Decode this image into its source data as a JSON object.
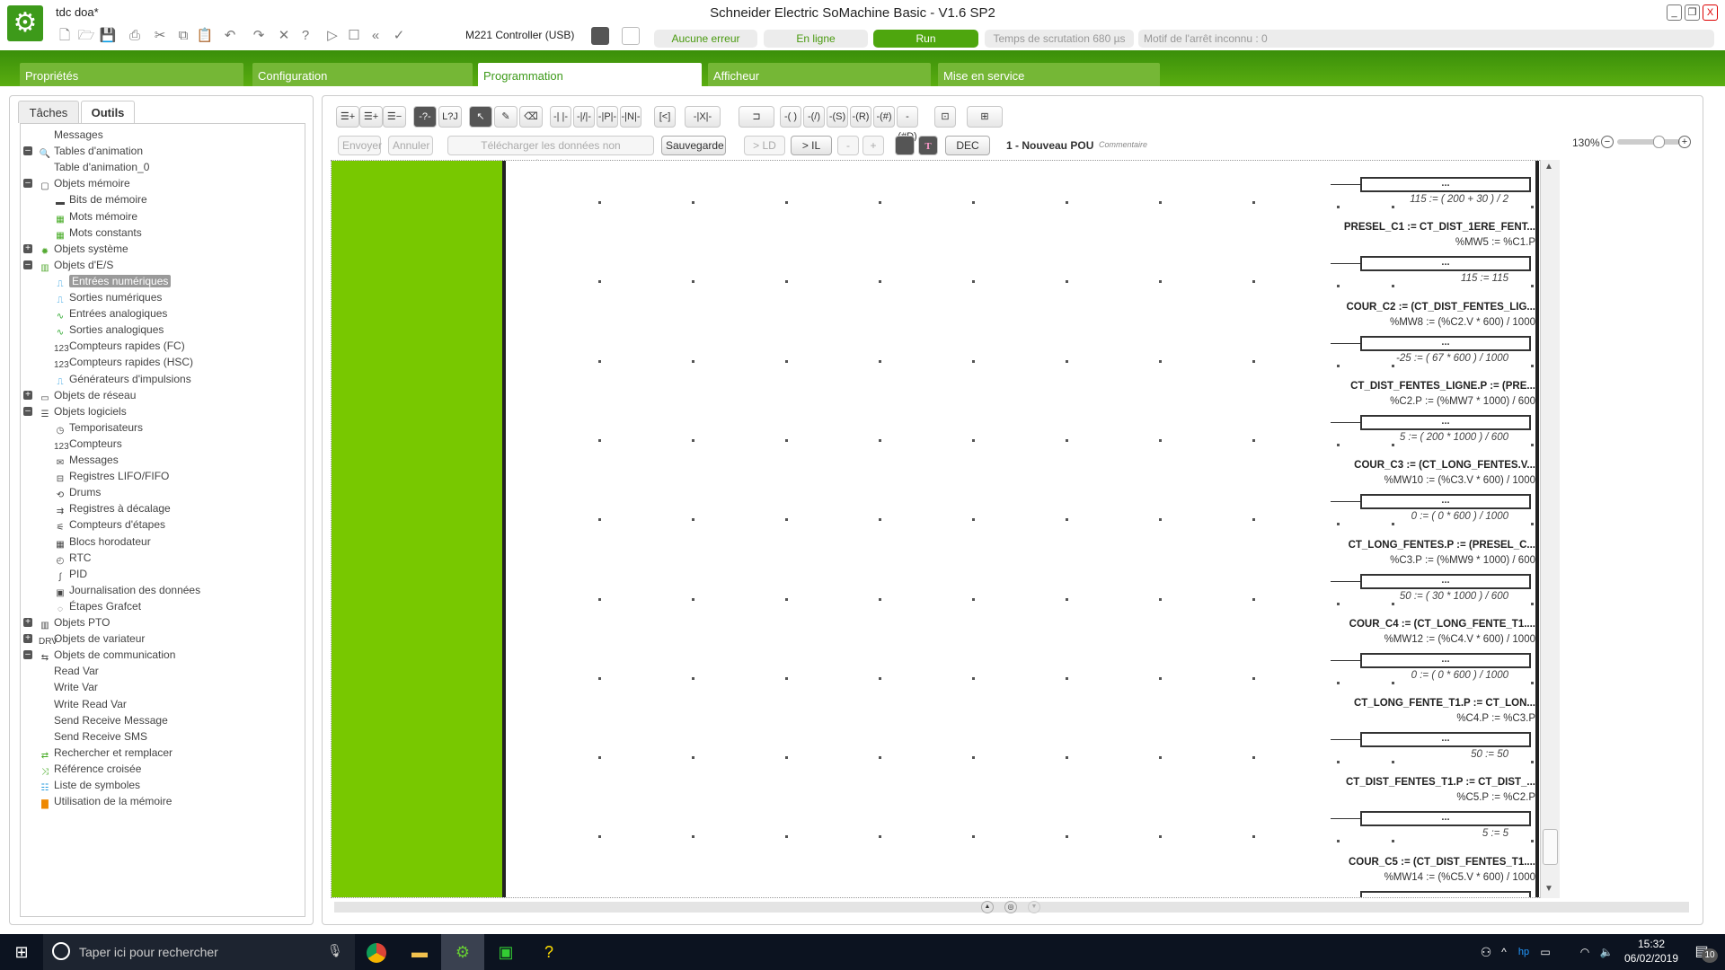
{
  "window": {
    "doc_title": "tdc doa*",
    "app_title": "Schneider Electric SoMachine Basic - V1.6 SP2",
    "min": "_",
    "restore": "❐",
    "close": "X"
  },
  "toolbar": {
    "controller": "M221 Controller (USB)",
    "icons": [
      "new-file-icon",
      "open-folder-icon",
      "save-icon",
      "print-icon",
      "cut-icon",
      "copy-icon",
      "paste-icon",
      "undo-icon",
      "redo-icon",
      "tools-icon",
      "help-icon",
      "start-icon",
      "stop-icon",
      "rewind-icon",
      "check-icon"
    ]
  },
  "status": {
    "error": "Aucune erreur",
    "online": "En ligne",
    "run": "Run",
    "scan": "Temps de scrutation 680 µs",
    "stop_reason": "Motif de l'arrêt inconnu : 0"
  },
  "main_tabs": [
    "Propriétés",
    "Configuration",
    "Programmation",
    "Afficheur",
    "Mise en service"
  ],
  "left_tabs": [
    "Tâches",
    "Outils"
  ],
  "tree": [
    {
      "label": "Messages",
      "level": 0,
      "exp": null,
      "icon": null
    },
    {
      "label": "Tables d'animation",
      "level": 0,
      "exp": "-",
      "icon": "magnifier"
    },
    {
      "label": "Table d'animation_0",
      "level": 1,
      "exp": null,
      "icon": null
    },
    {
      "label": "Objets mémoire",
      "level": 0,
      "exp": "-",
      "icon": "cube"
    },
    {
      "label": "Bits de mémoire",
      "level": 1,
      "exp": null,
      "icon": "bits"
    },
    {
      "label": "Mots mémoire",
      "level": 1,
      "exp": null,
      "icon": "words"
    },
    {
      "label": "Mots constants",
      "level": 1,
      "exp": null,
      "icon": "words"
    },
    {
      "label": "Objets système",
      "level": 0,
      "exp": "+",
      "icon": "gear"
    },
    {
      "label": "Objets d'E/S",
      "level": 0,
      "exp": "-",
      "icon": "io"
    },
    {
      "label": "Entrées numériques",
      "level": 1,
      "exp": null,
      "icon": "din",
      "selected": true
    },
    {
      "label": "Sorties numériques",
      "level": 1,
      "exp": null,
      "icon": "dout"
    },
    {
      "label": "Entrées analogiques",
      "level": 1,
      "exp": null,
      "icon": "ain"
    },
    {
      "label": "Sorties analogiques",
      "level": 1,
      "exp": null,
      "icon": "aout"
    },
    {
      "label": "Compteurs rapides (FC)",
      "level": 1,
      "exp": null,
      "icon": "counter"
    },
    {
      "label": "Compteurs rapides (HSC)",
      "level": 1,
      "exp": null,
      "icon": "counter"
    },
    {
      "label": "Générateurs d'impulsions",
      "level": 1,
      "exp": null,
      "icon": "pulse"
    },
    {
      "label": "Objets de réseau",
      "level": 0,
      "exp": "+",
      "icon": "network"
    },
    {
      "label": "Objets logiciels",
      "level": 0,
      "exp": "-",
      "icon": "software"
    },
    {
      "label": "Temporisateurs",
      "level": 1,
      "exp": null,
      "icon": "clock"
    },
    {
      "label": "Compteurs",
      "level": 1,
      "exp": null,
      "icon": "num"
    },
    {
      "label": "Messages",
      "level": 1,
      "exp": null,
      "icon": "message"
    },
    {
      "label": "Registres LIFO/FIFO",
      "level": 1,
      "exp": null,
      "icon": "stack"
    },
    {
      "label": "Drums",
      "level": 1,
      "exp": null,
      "icon": "drum"
    },
    {
      "label": "Registres à décalage",
      "level": 1,
      "exp": null,
      "icon": "shift"
    },
    {
      "label": "Compteurs d'étapes",
      "level": 1,
      "exp": null,
      "icon": "steps"
    },
    {
      "label": "Blocs horodateur",
      "level": 1,
      "exp": null,
      "icon": "calendar"
    },
    {
      "label": "RTC",
      "level": 1,
      "exp": null,
      "icon": "rtc"
    },
    {
      "label": "PID",
      "level": 1,
      "exp": null,
      "icon": "pid"
    },
    {
      "label": "Journalisation des données",
      "level": 1,
      "exp": null,
      "icon": "log"
    },
    {
      "label": "Étapes Grafcet",
      "level": 1,
      "exp": null,
      "icon": "grafcet"
    },
    {
      "label": "Objets PTO",
      "level": 0,
      "exp": "+",
      "icon": "pto"
    },
    {
      "label": "Objets de variateur",
      "level": 0,
      "exp": "+",
      "icon": "drive"
    },
    {
      "label": "Objets de communication",
      "level": 0,
      "exp": "-",
      "icon": "comm"
    },
    {
      "label": "Read Var",
      "level": 1,
      "exp": null,
      "icon": null
    },
    {
      "label": "Write Var",
      "level": 1,
      "exp": null,
      "icon": null
    },
    {
      "label": "Write Read Var",
      "level": 1,
      "exp": null,
      "icon": null
    },
    {
      "label": "Send Receive Message",
      "level": 1,
      "exp": null,
      "icon": null
    },
    {
      "label": "Send Receive SMS",
      "level": 1,
      "exp": null,
      "icon": null
    },
    {
      "label": "Rechercher et remplacer",
      "level": 0,
      "exp": null,
      "icon": "replace"
    },
    {
      "label": "Référence croisée",
      "level": 0,
      "exp": null,
      "icon": "crossref"
    },
    {
      "label": "Liste de symboles",
      "level": 0,
      "exp": null,
      "icon": "list"
    },
    {
      "label": "Utilisation de la mémoire",
      "level": 0,
      "exp": null,
      "icon": "memory"
    }
  ],
  "editor": {
    "actions": [
      "Envoyer",
      "Annuler",
      "Télécharger les données non exécutables",
      "Sauvegarde",
      "> LD",
      "> IL",
      "-",
      "+",
      "DEC"
    ],
    "pou_title": "1 - Nouveau POU",
    "pou_comment": "Commentaire",
    "zoom": "130%",
    "zoom_level": 0.7,
    "box_label": "...",
    "rungs": [
      {
        "title": "",
        "sub": "",
        "result": "115 := ( 200 + 30 ) / 2"
      },
      {
        "title": "PRESEL_C1 := CT_DIST_1ERE_FENT...",
        "sub": "%MW5 := %C1.P",
        "result": "115 := 115"
      },
      {
        "title": "COUR_C2 := (CT_DIST_FENTES_LIG...",
        "sub": "%MW8 := (%C2.V * 600) / 1000",
        "result": "-25 := ( 67 * 600 ) / 1000"
      },
      {
        "title": "CT_DIST_FENTES_LIGNE.P := (PRE...",
        "sub": "%C2.P := (%MW7 * 1000) / 600",
        "result": "5 := ( 200 * 1000 ) / 600"
      },
      {
        "title": "COUR_C3 := (CT_LONG_FENTES.V...",
        "sub": "%MW10 := (%C3.V * 600) / 1000",
        "result": "0 := ( 0 * 600 ) / 1000"
      },
      {
        "title": "CT_LONG_FENTES.P := (PRESEL_C...",
        "sub": "%C3.P := (%MW9 * 1000) / 600",
        "result": "50 := ( 30 * 1000 ) / 600"
      },
      {
        "title": "COUR_C4 := (CT_LONG_FENTE_T1....",
        "sub": "%MW12 := (%C4.V * 600) / 1000",
        "result": "0 := ( 0 * 600 ) / 1000"
      },
      {
        "title": "CT_LONG_FENTE_T1.P := CT_LON...",
        "sub": "%C4.P := %C3.P",
        "result": "50 := 50"
      },
      {
        "title": "CT_DIST_FENTES_T1.P := CT_DIST_...",
        "sub": "%C5.P := %C2.P",
        "result": "5 := 5"
      },
      {
        "title": "COUR_C5 := (CT_DIST_FENTES_T1....",
        "sub": "%MW14 := (%C5.V * 600) / 1000",
        "result": ""
      }
    ]
  },
  "taskbar": {
    "search": "Taper ici pour rechercher",
    "time": "15:32",
    "date": "06/02/2019",
    "notifications": "10"
  }
}
